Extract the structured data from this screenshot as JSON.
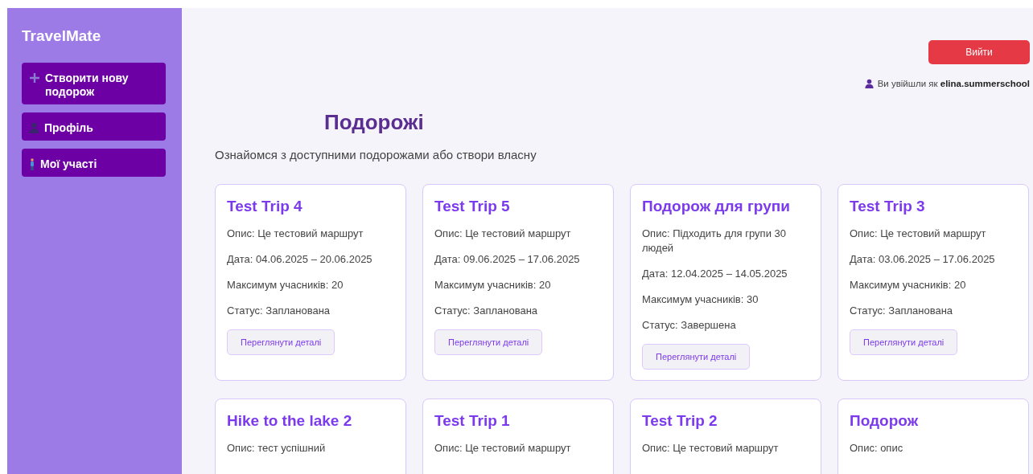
{
  "sidebar": {
    "title": "TravelMate",
    "items": [
      {
        "label": "Створити нову подорож",
        "kind": "plus"
      },
      {
        "label": "Профіль",
        "kind": "person"
      },
      {
        "label": "Мої участі",
        "kind": "standing"
      }
    ]
  },
  "header": {
    "logout_button": "Вийти",
    "login_status": "Ви увійшли як **elina.summerschool**"
  },
  "page": {
    "title": "Подорожі",
    "subtitle": "Ознайомся з доступними подорожами або створи власну"
  },
  "trips": [
    {
      "title": "Test Trip 4",
      "description": "Опис: Це тестовий маршрут",
      "dates": "Дата: 04.06.2025 – 20.06.2025",
      "max_participants": "Максимум учасників: 20",
      "status": "Статус: Запланована",
      "details_button": "Переглянути деталі"
    },
    {
      "title": "Test Trip 5",
      "description": "Опис: Це тестовий маршрут",
      "dates": "Дата: 09.06.2025 – 17.06.2025",
      "max_participants": "Максимум учасників: 20",
      "status": "Статус: Запланована",
      "details_button": "Переглянути деталі"
    },
    {
      "title": "Подорож для групи",
      "description": "Опис: Підходить для групи 30 людей",
      "dates": "Дата: 12.04.2025 – 14.05.2025",
      "max_participants": "Максимум учасників: 30",
      "status": "Статус: Завершена",
      "details_button": "Переглянути деталі"
    },
    {
      "title": "Test Trip 3",
      "description": "Опис: Це тестовий маршрут",
      "dates": "Дата: 03.06.2025 – 17.06.2025",
      "max_participants": "Максимум учасників: 20",
      "status": "Статус: Запланована",
      "details_button": "Переглянути деталі"
    },
    {
      "title": "Hike to the lake 2",
      "description": "Опис: тест успішний"
    },
    {
      "title": "Test Trip 1",
      "description": "Опис: Це тестовий маршрут"
    },
    {
      "title": "Test Trip 2",
      "description": "Опис: Це тестовий маршрут"
    },
    {
      "title": "Подорож",
      "description": "Опис: опис"
    }
  ]
}
